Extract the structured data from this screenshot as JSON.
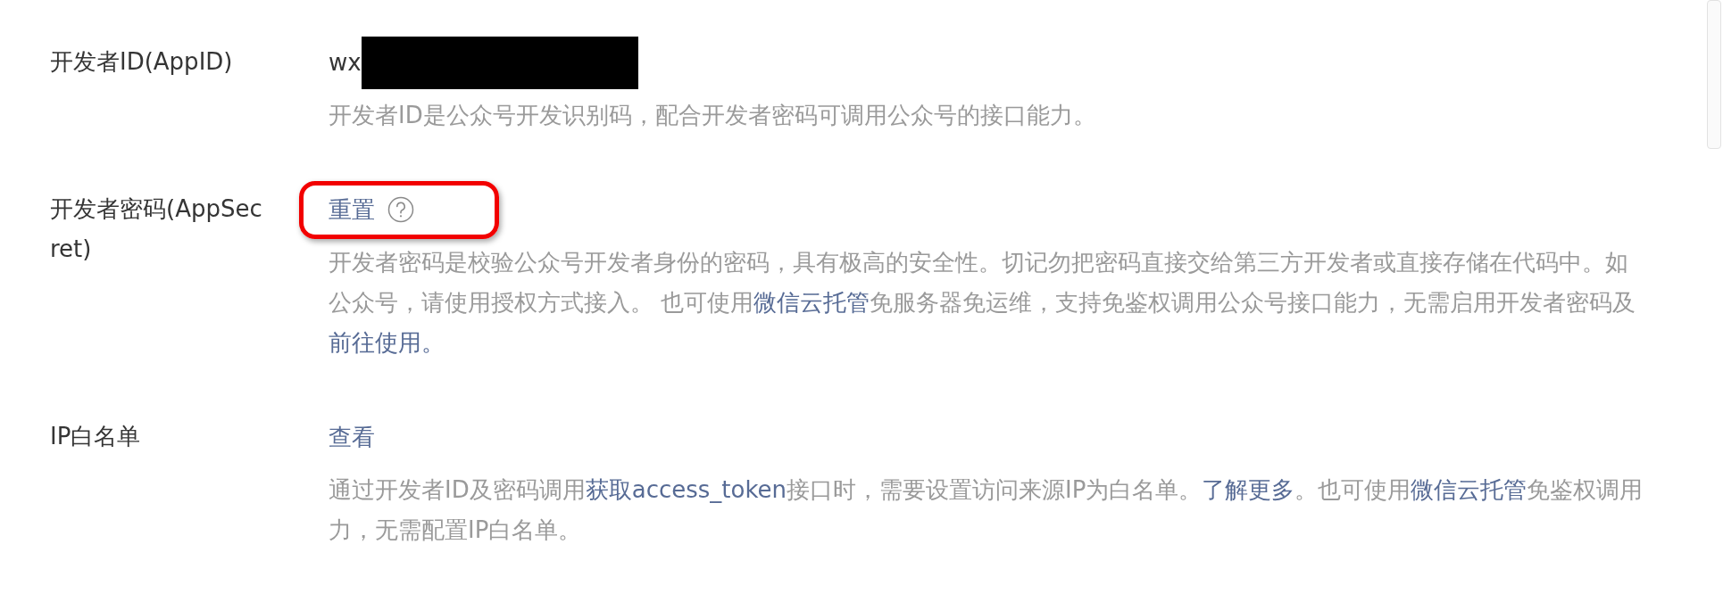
{
  "rows": [
    {
      "label_lines": [
        "开发者ID(AppID)"
      ],
      "value": {
        "kind": "text",
        "text": "wx",
        "redacted": true
      },
      "description_lines": [
        [
          {
            "text": "开发者ID是公众号开发识别码，配合开发者密码可调用公众号的接口能力。",
            "link": false
          }
        ]
      ]
    },
    {
      "label_lines": [
        "开发者密码(AppSec",
        "ret)"
      ],
      "value": {
        "kind": "link",
        "text": "重置",
        "help_icon": true,
        "highlighted": true
      },
      "description_lines": [
        [
          {
            "text": "开发者密码是校验公众号开发者身份的密码，具有极高的安全性。切记勿把密码直接交给第三方开发者或直接存储在代码中。如",
            "link": false
          }
        ],
        [
          {
            "text": "公众号，请使用授权方式接入。 也可使用",
            "link": false
          },
          {
            "text": "微信云托管",
            "link": true
          },
          {
            "text": "免服务器免运维，支持免鉴权调用公众号接口能力，无需启用开发者密码及",
            "link": false
          }
        ],
        [
          {
            "text": "前往使用。",
            "link": true
          }
        ]
      ]
    },
    {
      "label_lines": [
        "IP白名单"
      ],
      "value": {
        "kind": "link",
        "text": "查看",
        "help_icon": false,
        "highlighted": false
      },
      "description_lines": [
        [
          {
            "text": "通过开发者ID及密码调用",
            "link": false
          },
          {
            "text": "获取access_token",
            "link": true
          },
          {
            "text": "接口时，需要设置访问来源IP为白名单。",
            "link": false
          },
          {
            "text": "了解更多",
            "link": true
          },
          {
            "text": "。也可使用",
            "link": false
          },
          {
            "text": "微信云托管",
            "link": true
          },
          {
            "text": "免鉴权调用",
            "link": false
          }
        ],
        [
          {
            "text": "力，无需配置IP白名单。",
            "link": false
          }
        ]
      ]
    }
  ]
}
